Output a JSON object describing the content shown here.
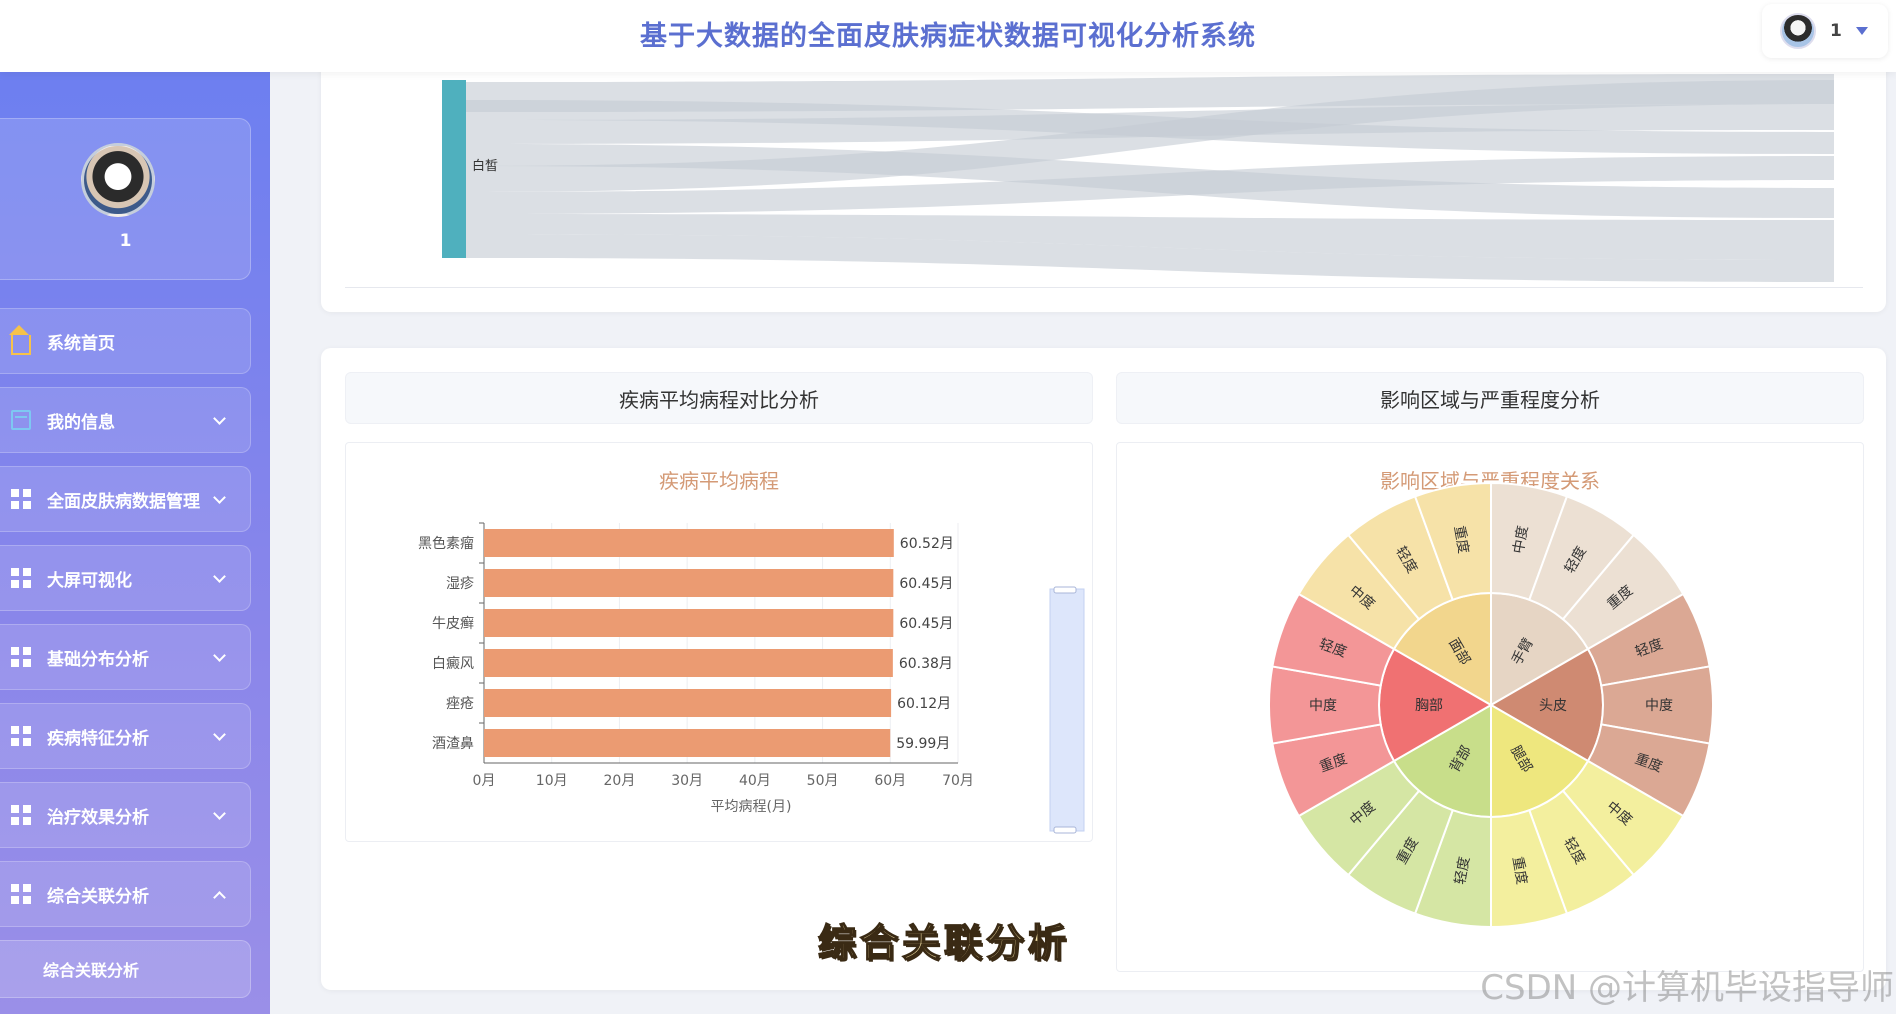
{
  "header": {
    "title": "基于大数据的全面皮肤病症状数据可视化分析系统",
    "user": "1"
  },
  "sidebar": {
    "profile_name": "1",
    "items": [
      {
        "label": "系统首页",
        "icon": "home-icon",
        "expanded": null
      },
      {
        "label": "我的信息",
        "icon": "card-icon",
        "expanded": false
      },
      {
        "label": "全面皮肤病数据管理",
        "icon": "grid-icon",
        "expanded": false
      },
      {
        "label": "大屏可视化",
        "icon": "grid-icon",
        "expanded": false
      },
      {
        "label": "基础分布分析",
        "icon": "grid-icon",
        "expanded": false
      },
      {
        "label": "疾病特征分析",
        "icon": "grid-icon",
        "expanded": false
      },
      {
        "label": "治疗效果分析",
        "icon": "grid-icon",
        "expanded": false
      },
      {
        "label": "综合关联分析",
        "icon": "grid-icon",
        "expanded": true
      }
    ],
    "submenu": [
      {
        "label": "综合关联分析"
      }
    ]
  },
  "sankey": {
    "node_label": "白皙",
    "node_color": "#4fb0be",
    "link_color": "#c5cbd3"
  },
  "sections": {
    "left_title": "疾病平均病程对比分析",
    "right_title": "影响区域与严重程度分析"
  },
  "chart_data": [
    {
      "type": "bar",
      "orientation": "horizontal",
      "title": "疾病平均病程",
      "xlabel": "平均病程(月)",
      "ylabel": "",
      "categories": [
        "黑色素瘤",
        "湿疹",
        "牛皮癣",
        "白癜风",
        "痤疮",
        "酒渣鼻"
      ],
      "values": [
        60.52,
        60.45,
        60.45,
        60.38,
        60.12,
        59.99
      ],
      "value_labels": [
        "60.52月",
        "60.45月",
        "60.45月",
        "60.38月",
        "60.12月",
        "59.99月"
      ],
      "xticks": [
        "0月",
        "10月",
        "20月",
        "30月",
        "40月",
        "50月",
        "60月",
        "70月"
      ],
      "xlim": [
        0,
        70
      ],
      "color": "#eb9b72",
      "grid": true
    },
    {
      "type": "sunburst",
      "title": "影响区域与严重程度关系",
      "inner": [
        {
          "name": "手臂",
          "color": "#e6d5c4",
          "children": [
            "中度",
            "轻度",
            "重度"
          ],
          "child_color": "#ece0d3"
        },
        {
          "name": "头皮",
          "color": "#cf8a72",
          "children": [
            "轻度",
            "中度",
            "重度"
          ],
          "child_color": "#dba894"
        },
        {
          "name": "腿部",
          "color": "#eee77e",
          "children": [
            "中度",
            "轻度",
            "重度"
          ],
          "child_color": "#f3ef9e"
        },
        {
          "name": "背部",
          "color": "#c8de8a",
          "children": [
            "轻度",
            "重度",
            "中度"
          ],
          "child_color": "#d5e6a4"
        },
        {
          "name": "胸部",
          "color": "#f07172",
          "children": [
            "重度",
            "中度",
            "轻度"
          ],
          "child_color": "#f39697"
        },
        {
          "name": "面部",
          "color": "#f2d68d",
          "children": [
            "中度",
            "轻度",
            "重度"
          ],
          "child_color": "#f6e2a8"
        }
      ]
    }
  ],
  "caption": "综合关联分析",
  "watermark": "CSDN @计算机毕设指导师"
}
